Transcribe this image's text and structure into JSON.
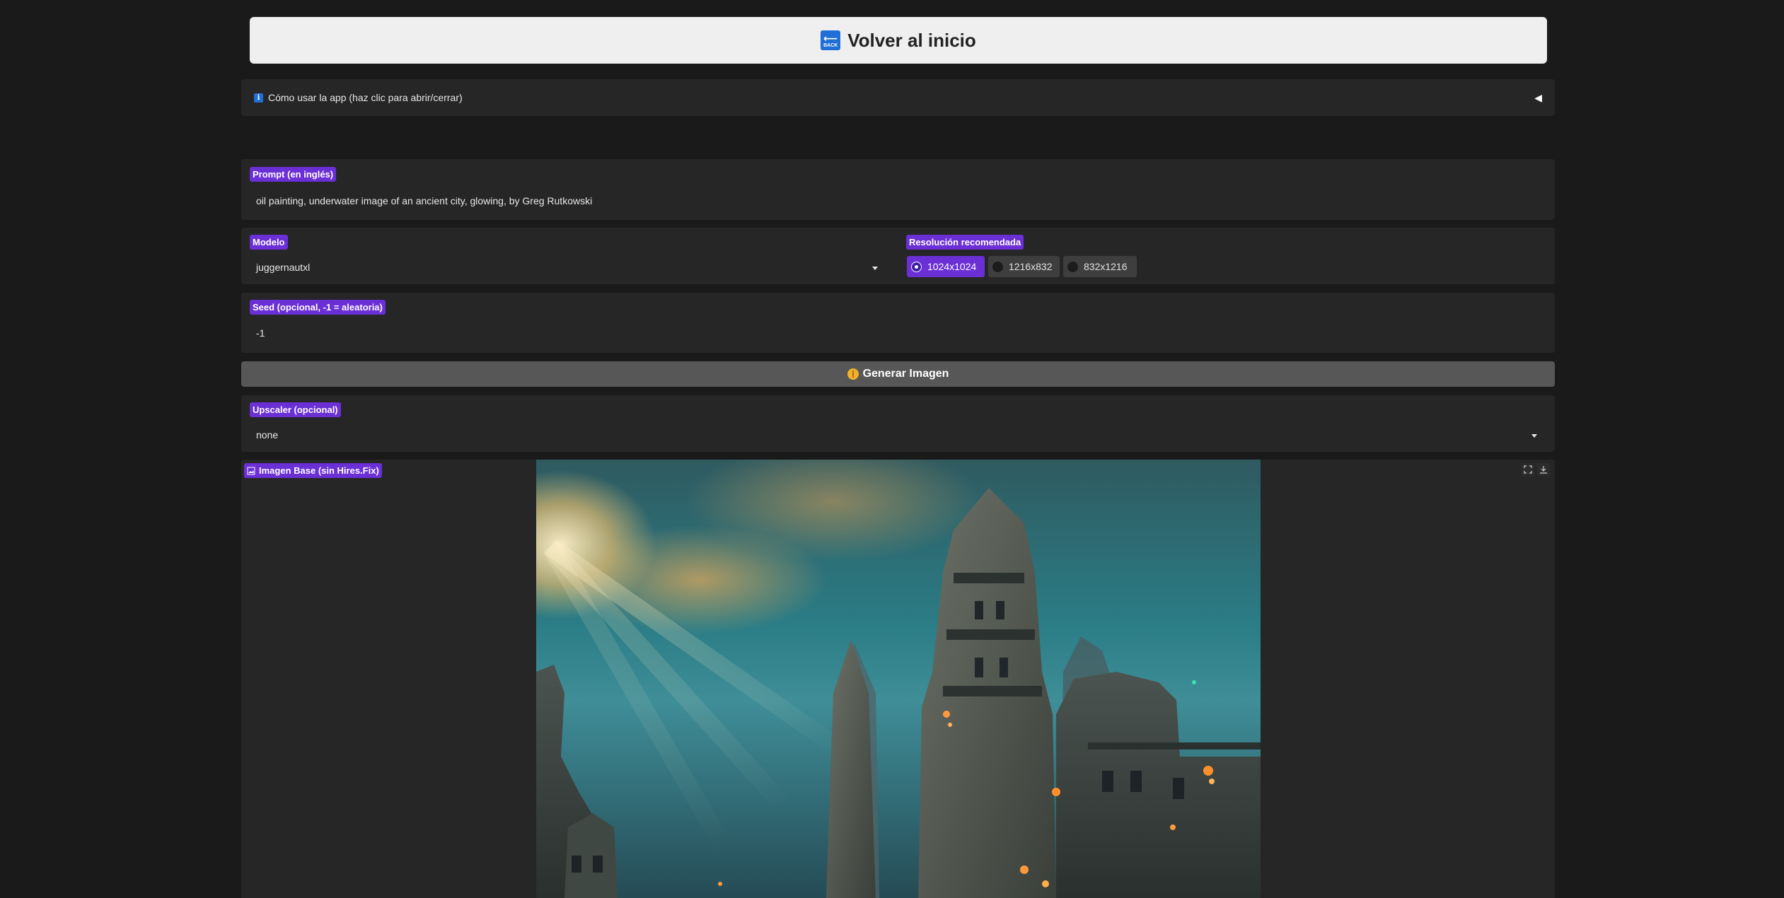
{
  "header": {
    "back_button_icon_arrow": "⟵",
    "back_button_icon_text": "BACK",
    "back_button_label": "Volver al inicio"
  },
  "accordion": {
    "icon": "info-icon",
    "label": "Cómo usar la app (haz clic para abrir/cerrar)",
    "caret": "◀"
  },
  "prompt": {
    "label": "Prompt (en inglés)",
    "value": "oil painting, underwater image of an ancient city, glowing, by Greg Rutkowski"
  },
  "model": {
    "label": "Modelo",
    "value": "juggernautxl"
  },
  "resolution": {
    "label": "Resolución recomendada",
    "options": [
      "1024x1024",
      "1216x832",
      "832x1216"
    ],
    "selected": "1024x1024"
  },
  "seed": {
    "label": "Seed (opcional, -1 = aleatoria)",
    "value": "-1"
  },
  "generate": {
    "label": "Generar Imagen",
    "icon": "brain-icon"
  },
  "upscaler": {
    "label": "Upscaler (opcional)",
    "value": "none"
  },
  "output": {
    "label": "Imagen Base (sin Hires.Fix)",
    "icons": [
      "fullscreen-icon",
      "download-icon"
    ]
  },
  "colors": {
    "background": "#1a1a1a",
    "panel": "#262626",
    "accent": "#6b2fd6",
    "button": "#575757"
  }
}
